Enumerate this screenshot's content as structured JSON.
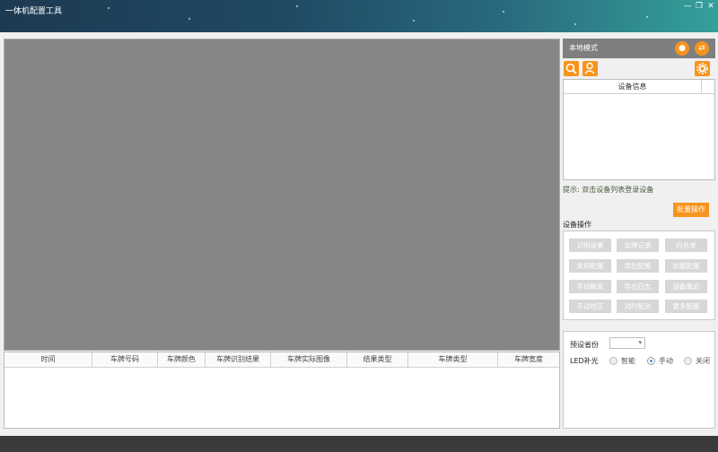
{
  "window": {
    "title": "一体机配置工具",
    "controls": [
      "—",
      "❐",
      "✕"
    ]
  },
  "table": {
    "columns": [
      "时间",
      "车牌号码",
      "车牌颜色",
      "车牌识别结果",
      "车牌实际图像",
      "结果类型",
      "车牌类型",
      "车牌宽度"
    ]
  },
  "panel": {
    "mode_label": "本地模式"
  },
  "device_list": {
    "header": "设备信息"
  },
  "hint": "提示: 双击设备列表登录设备",
  "batch_button": "批量操作",
  "ops_section": "设备操作",
  "ops": [
    "识别设置",
    "车牌记录",
    "白名单",
    "常用配置",
    "导出配置",
    "加载配置",
    "手动触发",
    "导出日志",
    "设备重启",
    "手动校正",
    "对时配对",
    "更多配置"
  ],
  "preset": {
    "label": "预设省份",
    "value": ""
  },
  "led": {
    "label": "LED补光",
    "options": [
      "智能",
      "手动",
      "关闭"
    ],
    "selected": "手动"
  },
  "colors": {
    "accent": "#f7941d",
    "video_bg": "#868686"
  }
}
